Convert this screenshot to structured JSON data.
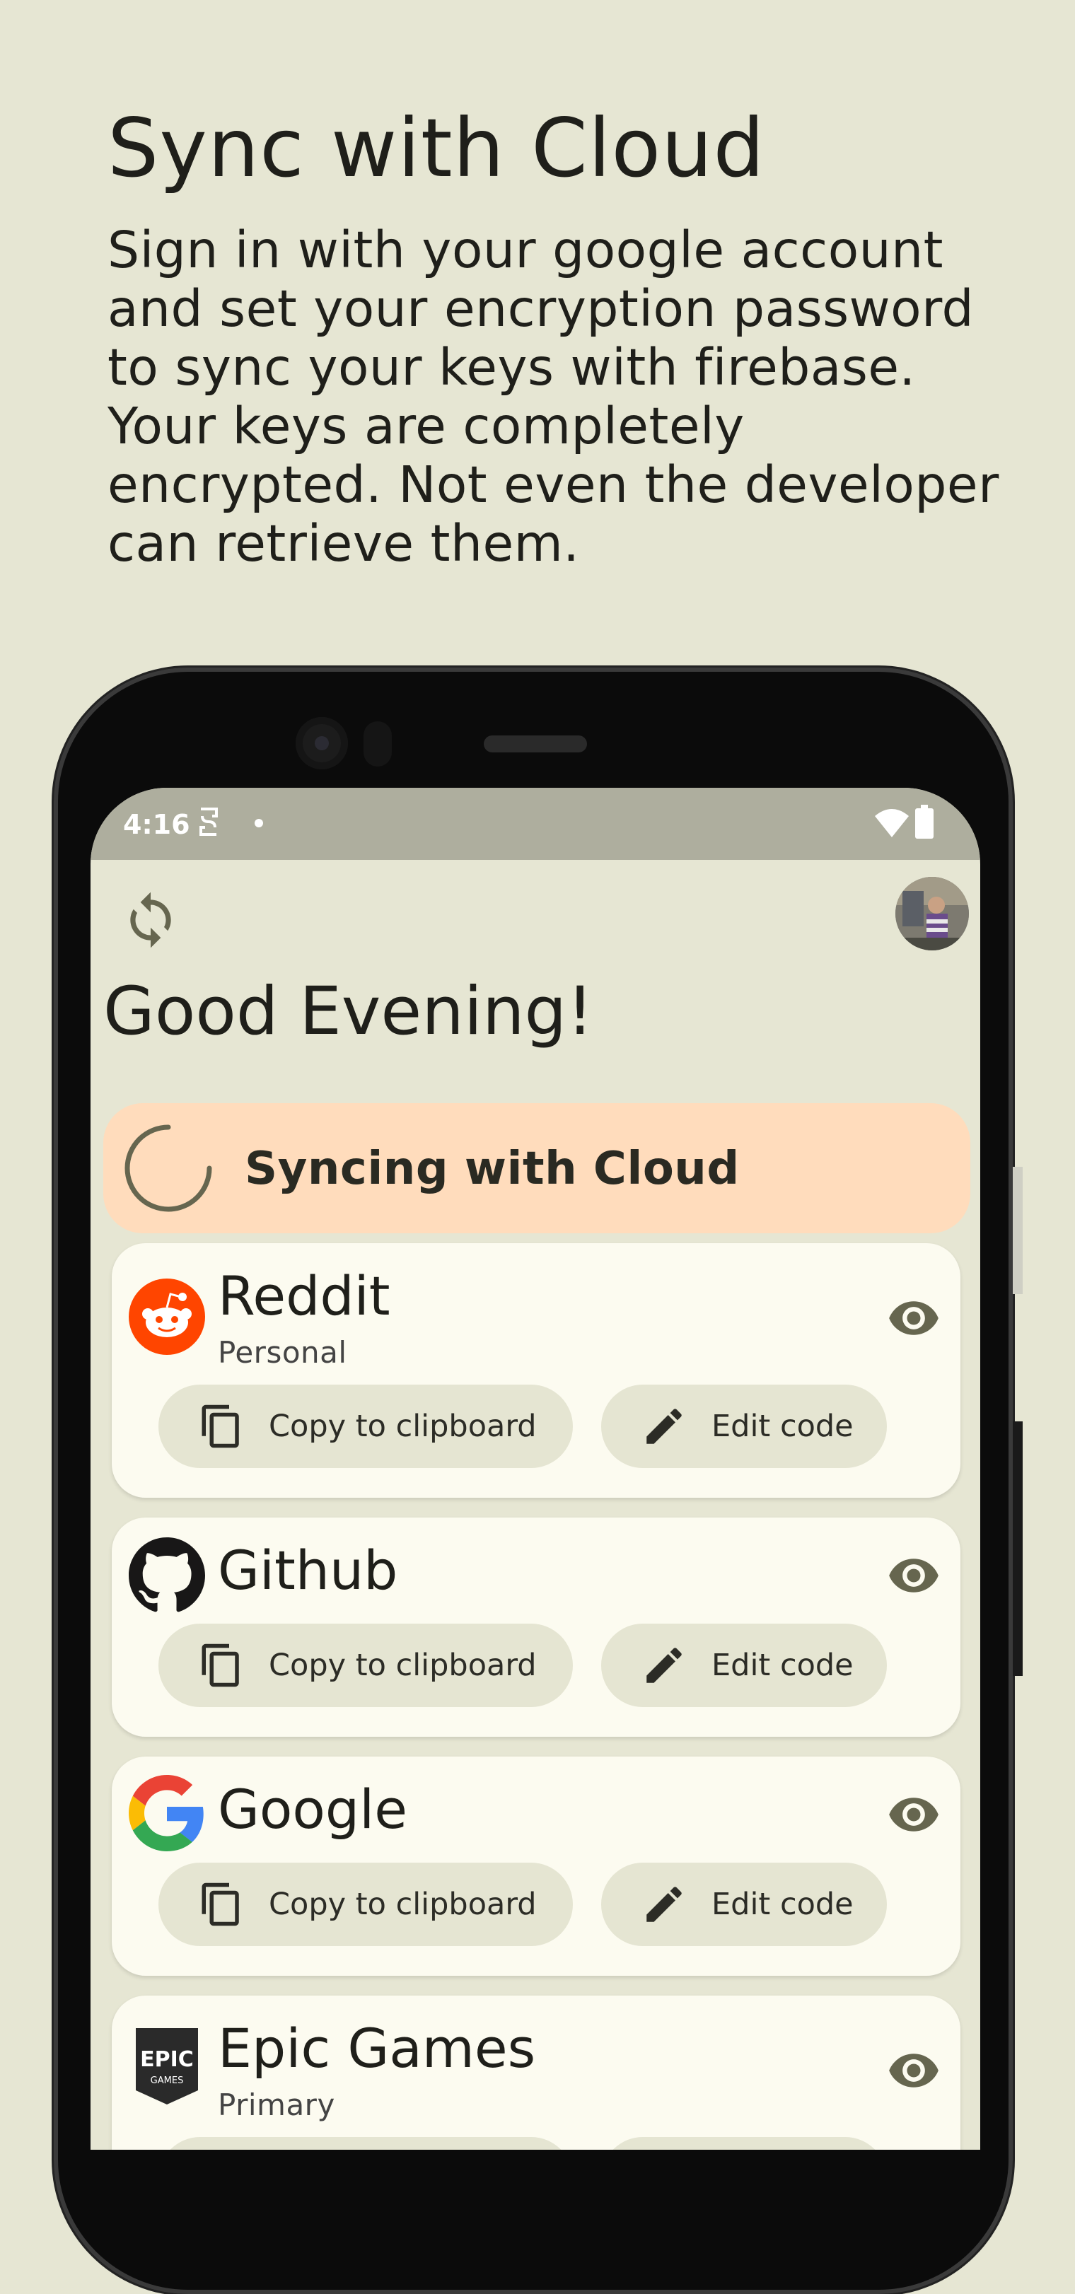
{
  "promo": {
    "title": "Sync with Cloud",
    "description": "Sign in with your google account and set your encryption password to sync your keys with firebase. Your keys are completely encrypted. Not even the developer can retrieve them."
  },
  "status_bar": {
    "time": "4:16"
  },
  "app": {
    "greeting": "Good Evening!",
    "sync_banner": "Syncing with Cloud",
    "copy_label": "Copy to clipboard",
    "edit_label": "Edit code",
    "accounts": [
      {
        "name": "Reddit",
        "tag": "Personal",
        "brand_color": "#ff4500"
      },
      {
        "name": "Github",
        "tag": "",
        "brand_color": "#181717"
      },
      {
        "name": "Google",
        "tag": "",
        "brand_color": "#4285f4"
      },
      {
        "name": "Epic Games",
        "tag": "Primary",
        "brand_color": "#2a2a2a"
      }
    ]
  },
  "colors": {
    "background": "#e6e6d3",
    "card": "#fcfbf0",
    "banner": "#ffdcbc",
    "status_bar": "#aeae9e",
    "icon": "#66664f"
  }
}
